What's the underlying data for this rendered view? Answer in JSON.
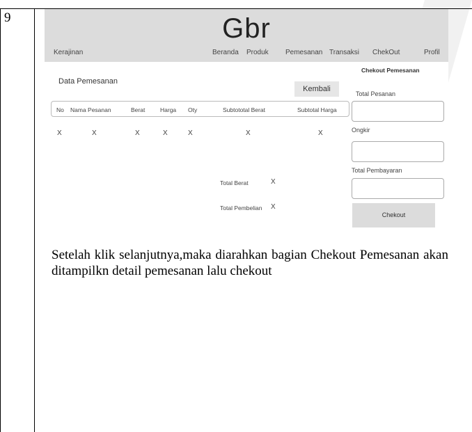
{
  "row_number": "9",
  "mockup": {
    "logo": "Gbr",
    "brand": "Kerajinan",
    "nav": [
      "Beranda",
      "Produk",
      "Pemesanan",
      "Transaksi",
      "ChekOut",
      "Profil"
    ],
    "section_title": "Data Pemesanan",
    "back_button": "Kembali",
    "table": {
      "headers": [
        "No",
        "Nama Pesanan",
        "Berat",
        "Harga",
        "Oty",
        "Subtototal Berat",
        "Subtotal Harga"
      ],
      "row": [
        "X",
        "X",
        "X",
        "X",
        "X",
        "X",
        "X"
      ]
    },
    "summary": {
      "total_berat_label": "Total Berat",
      "total_berat_value": "X",
      "total_pembelian_label": "Total Pembelian",
      "total_pembelian_value": "X"
    },
    "checkout": {
      "title": "Chekout Pemesanan",
      "total_pesanan_label": "Total Pesanan",
      "ongkir_label": "Ongkir",
      "total_pembayaran_label": "Total Pembayaran",
      "button": "Chekout"
    }
  },
  "caption": "Setelah klik selanjutnya,maka diarahkan bagian Chekout Pemesanan akan ditampilkn detail pemesanan lalu chekout"
}
